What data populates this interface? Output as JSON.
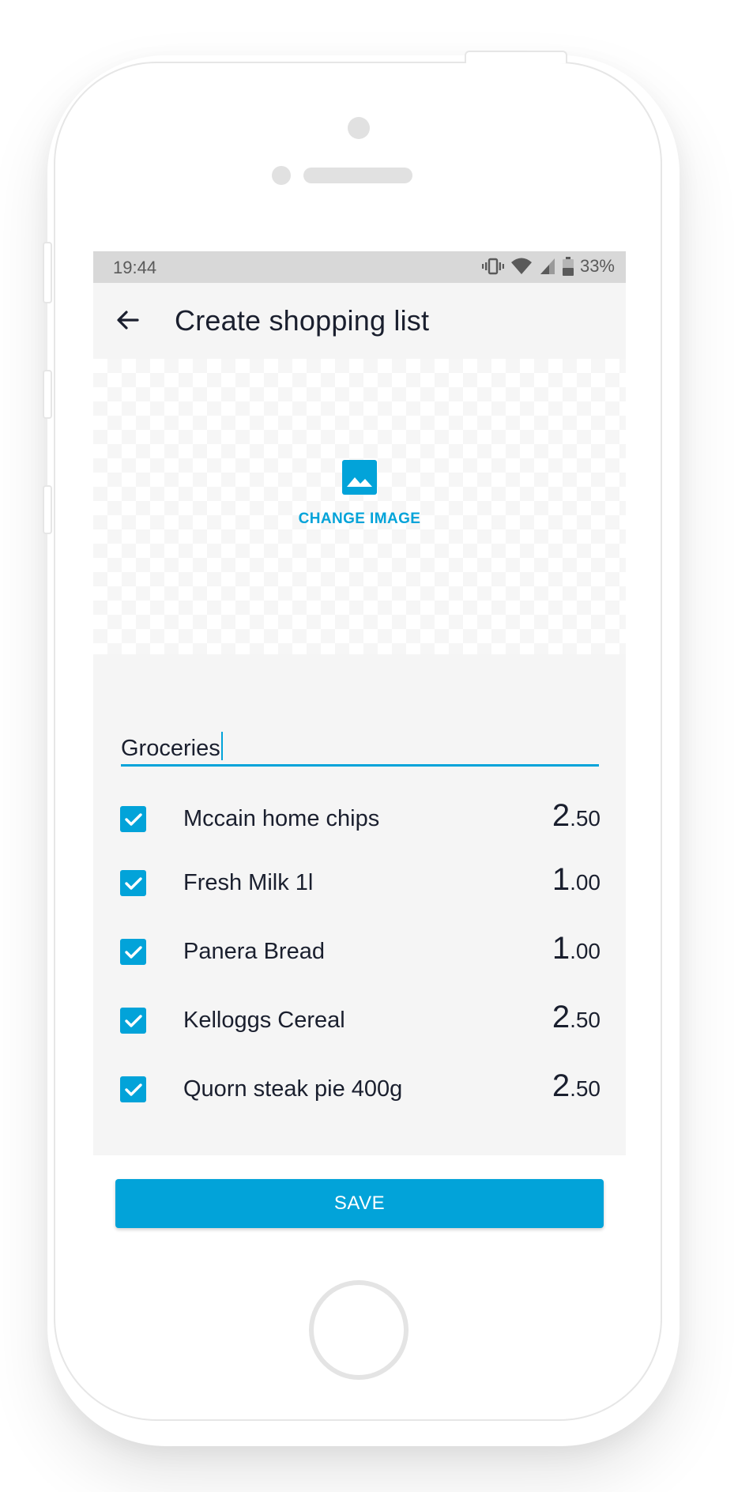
{
  "status_bar": {
    "time": "19:44",
    "battery_percent": "33%",
    "icons": [
      "vibrate-icon",
      "wifi-icon",
      "signal-icon",
      "battery-icon"
    ]
  },
  "app_bar": {
    "back_icon": "arrow-left-icon",
    "title": "Create shopping list"
  },
  "image_picker": {
    "icon": "image-icon",
    "label": "CHANGE IMAGE"
  },
  "list_name": {
    "value": "Groceries"
  },
  "items": [
    {
      "name": "Mccain home chips",
      "price_int": "2",
      "price_dec": ".50",
      "checked": true
    },
    {
      "name": "Fresh Milk 1l",
      "price_int": "1",
      "price_dec": ".00",
      "checked": true
    },
    {
      "name": "Panera Bread",
      "price_int": "1",
      "price_dec": ".00",
      "checked": true
    },
    {
      "name": "Kelloggs Cereal",
      "price_int": "2",
      "price_dec": ".50",
      "checked": true
    },
    {
      "name": "Quorn steak pie 400g",
      "price_int": "2",
      "price_dec": ".50",
      "checked": true
    }
  ],
  "save_button": {
    "label": "SAVE"
  },
  "colors": {
    "accent": "#02a3d9",
    "text": "#1a1f2e",
    "status_bar": "#d8d8d8",
    "screen_bg": "#f5f5f5"
  }
}
